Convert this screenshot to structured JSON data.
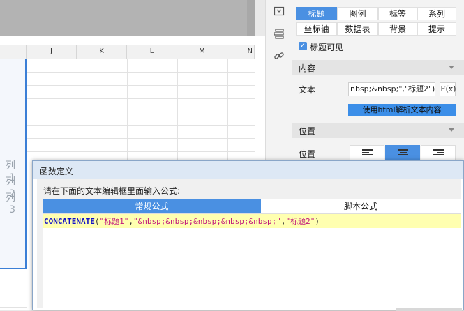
{
  "spreadsheet": {
    "columns": [
      "I",
      "J",
      "K",
      "L",
      "M",
      "N"
    ],
    "series_labels": [
      "列1",
      "列2",
      "列3"
    ]
  },
  "icon_strip": [
    "panel-icon",
    "layers-icon",
    "link-icon"
  ],
  "panel": {
    "tabs_row1": [
      "标题",
      "图例",
      "标签",
      "系列"
    ],
    "tabs_row2": [
      "坐标轴",
      "数据表",
      "背景",
      "提示"
    ],
    "active_tab": "标题",
    "title_visible_label": "标题可见",
    "title_visible_checked": true,
    "content_section": "内容",
    "text_label": "文本",
    "text_value": "nbsp;&nbsp;\",\"标题2\")",
    "fx_label": "F(x)",
    "html_button": "使用html解析文本内容",
    "position_section": "位置",
    "position_label": "位置",
    "align_options": [
      "left",
      "center",
      "right"
    ],
    "align_selected": "center"
  },
  "dialog": {
    "title": "函数定义",
    "instruction": "请在下面的文本编辑框里面输入公式:",
    "tabs": [
      "常规公式",
      "脚本公式"
    ],
    "active_tab": "常规公式",
    "formula": {
      "function": "CONCATENATE",
      "open": "(",
      "arg1": "\"标题1\"",
      "comma1": ",",
      "arg2": "\"&nbsp;&nbsp;&nbsp;&nbsp;&nbsp;\"",
      "comma2": ",",
      "arg3": "\"标题2\"",
      "close": ")"
    }
  },
  "colors": {
    "accent": "#4a90e2",
    "highlight_line": "#ffffb0",
    "function_color": "#1010c8",
    "string_color": "#c0187d"
  }
}
